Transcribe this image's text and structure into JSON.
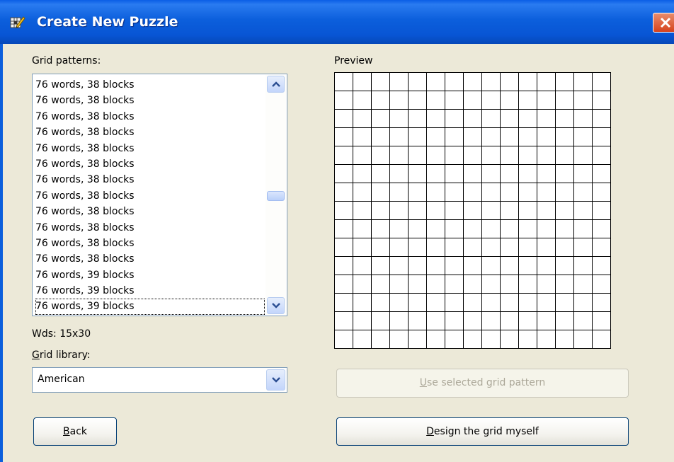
{
  "window": {
    "title": "Create New Puzzle",
    "title_icon": "pencil-grid-icon",
    "close_icon": "close-icon"
  },
  "grid_patterns": {
    "label": "Grid patterns:",
    "items": [
      "76 words, 38 blocks",
      "76 words, 38 blocks",
      "76 words, 38 blocks",
      "76 words, 38 blocks",
      "76 words, 38 blocks",
      "76 words, 38 blocks",
      "76 words, 38 blocks",
      "76 words, 38 blocks",
      "76 words, 38 blocks",
      "76 words, 38 blocks",
      "76 words, 38 blocks",
      "76 words, 38 blocks",
      "76 words, 39 blocks",
      "76 words, 39 blocks",
      "76 words, 39 blocks"
    ],
    "scroll_position": 0.5
  },
  "status_text": "Wds: 15x30",
  "grid_library": {
    "label_accel": "G",
    "label_rest": "rid library:",
    "selected": "American"
  },
  "preview": {
    "label": "Preview",
    "rows": 15,
    "columns": 15
  },
  "buttons": {
    "back_accel": "B",
    "back_rest": "ack",
    "use_pattern_accel": "U",
    "use_pattern_rest": "se selected grid pattern",
    "design_accel": "D",
    "design_rest": "esign the grid myself"
  },
  "colors": {
    "titlebar": "#0c5fdc",
    "dialog_bg": "#ece9d8",
    "close_button": "#d6421c"
  }
}
